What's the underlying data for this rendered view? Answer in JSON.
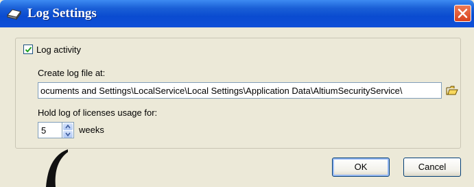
{
  "dialog": {
    "title": "Log Settings",
    "log_activity": {
      "label": "Log activity",
      "checked": true
    },
    "create_log_label": "Create log file at:",
    "log_path_value": "ocuments and Settings\\LocalService\\Local Settings\\Application Data\\AltiumSecurityService\\",
    "hold_log_label": "Hold log of licenses usage for:",
    "weeks_value": "5",
    "weeks_unit": "weeks",
    "ok_label": "OK",
    "cancel_label": "Cancel"
  },
  "icons": {
    "title": "printer-icon",
    "close": "close-icon",
    "browse": "folder-open-icon",
    "spin_up": "chevron-up-icon",
    "spin_down": "chevron-down-icon"
  },
  "colors": {
    "titlebar": "#0a4bd0",
    "close_button": "#d8421d",
    "dialog_background": "#ece9d8",
    "field_border": "#7f9db9"
  }
}
